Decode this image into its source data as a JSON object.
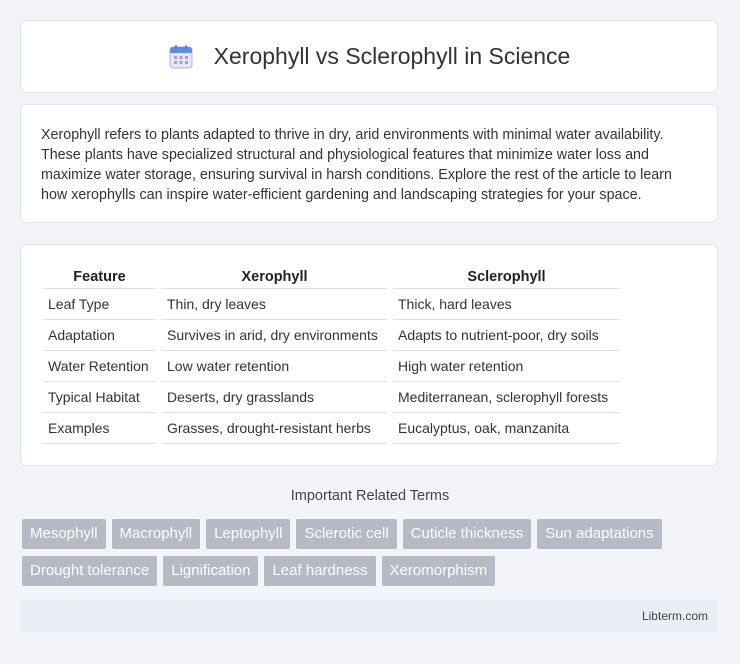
{
  "header": {
    "title": "Xerophyll vs Sclerophyll in Science",
    "icon": "calendar-icon"
  },
  "intro": {
    "text": "Xerophyll refers to plants adapted to thrive in dry, arid environments with minimal water availability. These plants have specialized structural and physiological features that minimize water loss and maximize water storage, ensuring survival in harsh conditions. Explore the rest of the article to learn how xerophylls can inspire water-efficient gardening and landscaping strategies for your space."
  },
  "table": {
    "headers": [
      "Feature",
      "Xerophyll",
      "Sclerophyll"
    ],
    "rows": [
      [
        "Leaf Type",
        "Thin, dry leaves",
        "Thick, hard leaves"
      ],
      [
        "Adaptation",
        "Survives in arid, dry environments",
        "Adapts to nutrient-poor, dry soils"
      ],
      [
        "Water Retention",
        "Low water retention",
        "High water retention"
      ],
      [
        "Typical Habitat",
        "Deserts, dry grasslands",
        "Mediterranean, sclerophyll forests"
      ],
      [
        "Examples",
        "Grasses, drought-resistant herbs",
        "Eucalyptus, oak, manzanita"
      ]
    ]
  },
  "related": {
    "title": "Important Related Terms",
    "tags": [
      "Mesophyll",
      "Macrophyll",
      "Leptophyll",
      "Sclerotic cell",
      "Cuticle thickness",
      "Sun adaptations",
      "Drought tolerance",
      "Lignification",
      "Leaf hardness",
      "Xeromorphism"
    ]
  },
  "footer": {
    "brand": "Libterm.com"
  }
}
